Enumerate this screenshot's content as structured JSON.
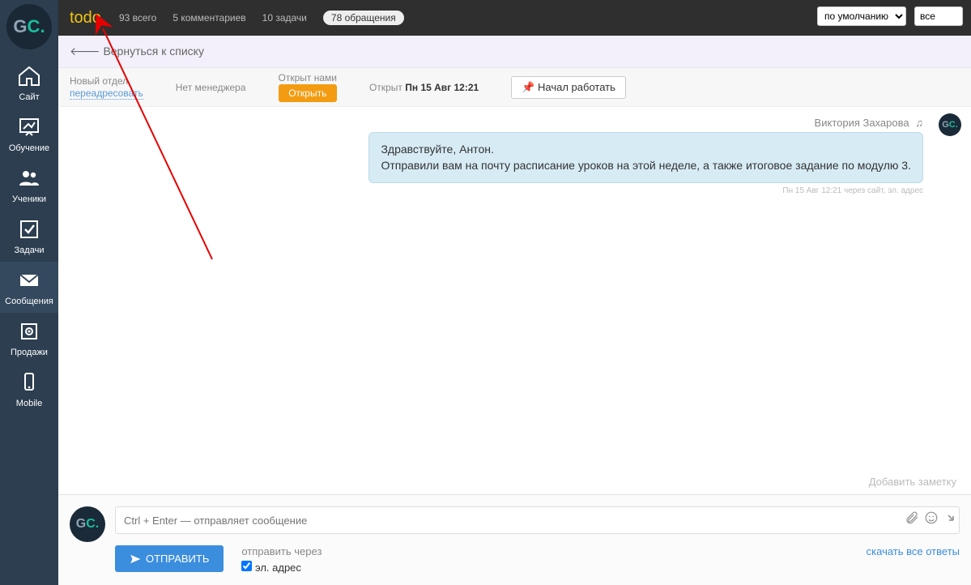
{
  "sidebar": {
    "items": [
      {
        "label": "Сайт"
      },
      {
        "label": "Обучение"
      },
      {
        "label": "Ученики"
      },
      {
        "label": "Задачи"
      },
      {
        "label": "Сообщения"
      },
      {
        "label": "Продажи"
      },
      {
        "label": "Mobile"
      }
    ]
  },
  "topbar": {
    "todo": "todo",
    "total": "93 всего",
    "comments": "5 комментариев",
    "tasks": "10 задачи",
    "appeals": "78 обращения",
    "sort_value": "по умолчанию",
    "filter_value": "все"
  },
  "back": {
    "label": "Вернуться к списку"
  },
  "info": {
    "dept_label": "Новый отдел",
    "redirect": "переадресовать",
    "no_manager": "Нет менеджера",
    "opened_by_us": "Открыт нами",
    "open_btn": "Открыть",
    "opened_label": "Открыт",
    "opened_time": "Пн 15 Авг 12:21",
    "started_btn": "Начал работать"
  },
  "conversation": {
    "author": "Виктория Захарова",
    "msg_line1": "Здравствуйте, Антон.",
    "msg_line2": "Отправили вам на почту расписание уроков на этой неделе, а также итоговое задание по модулю 3.",
    "meta": "Пн 15 Авг 12:21 через сайт, эл. адрес",
    "add_note": "Добавить заметку"
  },
  "composer": {
    "placeholder": "Ctrl + Enter — отправляет сообщение",
    "send": "ОТПРАВИТЬ",
    "send_via_label": "отправить через",
    "email_label": "эл. адрес",
    "download_all": "скачать все ответы"
  }
}
